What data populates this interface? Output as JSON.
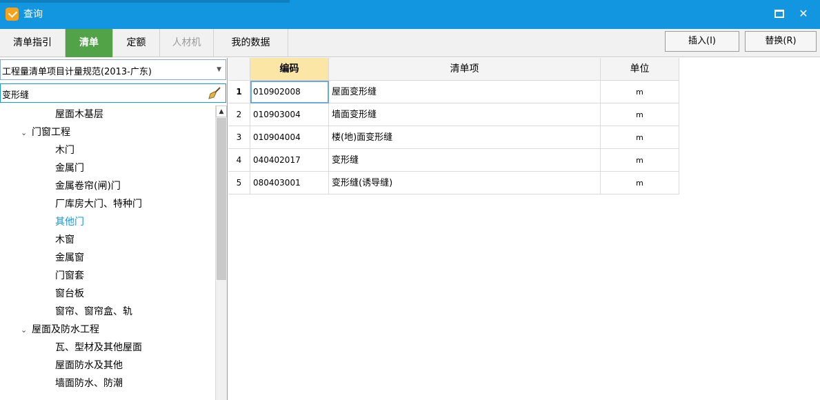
{
  "window": {
    "title": "查询"
  },
  "tabs": [
    {
      "label": "清单指引",
      "state": "normal"
    },
    {
      "label": "清单",
      "state": "active"
    },
    {
      "label": "定额",
      "state": "normal"
    },
    {
      "label": "人材机",
      "state": "disabled"
    },
    {
      "label": "我的数据",
      "state": "normal"
    }
  ],
  "actions": {
    "insert_label": "插入(I)",
    "replace_label": "替换(R)"
  },
  "left_panel": {
    "standard_select": "工程量清单项目计量规范(2013-广东)",
    "search_value": "变形缝",
    "tree": [
      {
        "label": "屋面木基层",
        "level": 2,
        "expanded": null
      },
      {
        "label": "门窗工程",
        "level": 1,
        "expanded": true
      },
      {
        "label": "木门",
        "level": 2,
        "expanded": null
      },
      {
        "label": "金属门",
        "level": 2,
        "expanded": null
      },
      {
        "label": "金属卷帘(闸)门",
        "level": 2,
        "expanded": null
      },
      {
        "label": "厂库房大门、特种门",
        "level": 2,
        "expanded": null
      },
      {
        "label": "其他门",
        "level": 2,
        "expanded": null,
        "selected": true
      },
      {
        "label": "木窗",
        "level": 2,
        "expanded": null
      },
      {
        "label": "金属窗",
        "level": 2,
        "expanded": null
      },
      {
        "label": "门窗套",
        "level": 2,
        "expanded": null
      },
      {
        "label": "窗台板",
        "level": 2,
        "expanded": null
      },
      {
        "label": "窗帘、窗帘盒、轨",
        "level": 2,
        "expanded": null
      },
      {
        "label": "屋面及防水工程",
        "level": 1,
        "expanded": true
      },
      {
        "label": "瓦、型材及其他屋面",
        "level": 2,
        "expanded": null
      },
      {
        "label": "屋面防水及其他",
        "level": 2,
        "expanded": null
      },
      {
        "label": "墙面防水、防潮",
        "level": 2,
        "expanded": null
      }
    ]
  },
  "table": {
    "headers": {
      "code": "编码",
      "name": "清单项",
      "unit": "单位"
    },
    "rows": [
      {
        "num": "1",
        "code": "010902008",
        "name": "屋面变形缝",
        "unit": "m"
      },
      {
        "num": "2",
        "code": "010903004",
        "name": "墙面变形缝",
        "unit": "m"
      },
      {
        "num": "3",
        "code": "010904004",
        "name": "楼(地)面变形缝",
        "unit": "m"
      },
      {
        "num": "4",
        "code": "040402017",
        "name": "变形缝",
        "unit": "m"
      },
      {
        "num": "5",
        "code": "080403001",
        "name": "变形缝(诱导缝)",
        "unit": "m"
      }
    ],
    "active_row": 0
  },
  "colors": {
    "titlebar": "#1296e0",
    "tab_active": "#52a347",
    "selected_tree": "#1296e0",
    "code_header": "#fbe6a6"
  }
}
